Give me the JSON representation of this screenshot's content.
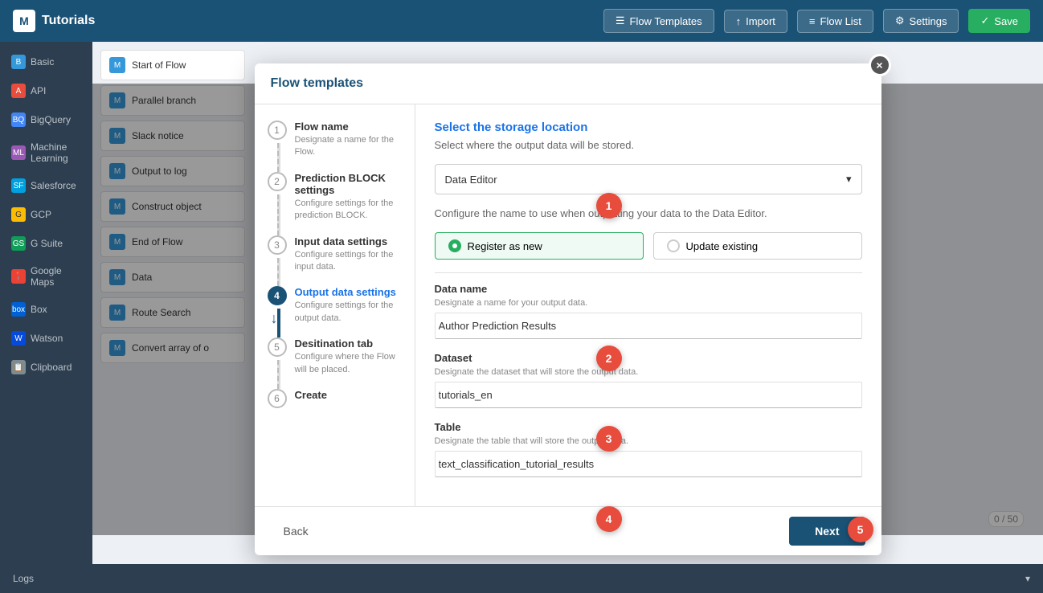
{
  "app": {
    "title": "Tutorials"
  },
  "nav": {
    "flow_templates_label": "Flow Templates",
    "import_label": "Import",
    "flow_list_label": "Flow List",
    "settings_label": "Settings",
    "save_label": "Save"
  },
  "sidebar": {
    "items": [
      {
        "id": "basic",
        "label": "Basic",
        "icon": "B"
      },
      {
        "id": "api",
        "label": "API",
        "icon": "A"
      },
      {
        "id": "bigquery",
        "label": "BigQuery",
        "icon": "BQ"
      },
      {
        "id": "ml",
        "label": "Machine Learning",
        "icon": "ML"
      },
      {
        "id": "salesforce",
        "label": "Salesforce",
        "icon": "SF"
      },
      {
        "id": "gcp",
        "label": "GCP",
        "icon": "G"
      },
      {
        "id": "gsuite",
        "label": "G Suite",
        "icon": "GS"
      },
      {
        "id": "maps",
        "label": "Google Maps",
        "icon": "📍"
      },
      {
        "id": "box",
        "label": "Box",
        "icon": "box"
      },
      {
        "id": "watson",
        "label": "Watson",
        "icon": "W"
      },
      {
        "id": "clipboard",
        "label": "Clipboard",
        "icon": "📋"
      }
    ]
  },
  "flow_items": [
    {
      "id": "start",
      "label": "Start of Flow"
    },
    {
      "id": "parallel",
      "label": "Parallel branch"
    },
    {
      "id": "slack",
      "label": "Slack notice"
    },
    {
      "id": "output",
      "label": "Output to log"
    },
    {
      "id": "construct",
      "label": "Construct object"
    },
    {
      "id": "end",
      "label": "End of Flow"
    },
    {
      "id": "data",
      "label": "Data"
    },
    {
      "id": "route",
      "label": "Route Search"
    },
    {
      "id": "convert",
      "label": "Convert array of o"
    }
  ],
  "modal": {
    "title": "Flow templates",
    "close_label": "×",
    "steps": [
      {
        "id": 1,
        "label": "Flow name",
        "desc": "Designate a name for the Flow.",
        "active": false
      },
      {
        "id": 2,
        "label": "Prediction BLOCK settings",
        "desc": "Configure settings for the prediction BLOCK.",
        "active": false
      },
      {
        "id": 3,
        "label": "Input data settings",
        "desc": "Configure settings for the input data.",
        "active": false
      },
      {
        "id": 4,
        "label": "Output data settings",
        "desc": "Configure settings for the output data.",
        "active": true
      },
      {
        "id": 5,
        "label": "Desitination tab",
        "desc": "Configure where the Flow will be placed.",
        "active": false
      },
      {
        "id": 6,
        "label": "Create",
        "desc": "",
        "active": false
      }
    ],
    "content": {
      "section_title": "Select the storage location",
      "section_desc": "Select where the output data will be stored.",
      "storage_label": "Data Editor",
      "storage_desc": "Configure the name to use when outputting your data to the Data Editor.",
      "register_label": "Register as new",
      "update_label": "Update existing",
      "data_name_label": "Data name",
      "data_name_desc": "Designate a name for your output data.",
      "data_name_value": "Author Prediction Results",
      "dataset_label": "Dataset",
      "dataset_desc": "Designate the dataset that will store the output data.",
      "dataset_value": "tutorials_en",
      "table_label": "Table",
      "table_desc": "Designate the table that will store the output data.",
      "table_value": "text_classification_tutorial_results"
    },
    "footer": {
      "back_label": "Back",
      "next_label": "Next"
    }
  },
  "callouts": [
    {
      "id": 1,
      "label": "1"
    },
    {
      "id": 2,
      "label": "2"
    },
    {
      "id": 3,
      "label": "3"
    },
    {
      "id": 4,
      "label": "4"
    },
    {
      "id": 5,
      "label": "5"
    }
  ],
  "log_bar": {
    "label": "Logs",
    "icon": "▾"
  },
  "counter": {
    "value": "0 / 50"
  }
}
